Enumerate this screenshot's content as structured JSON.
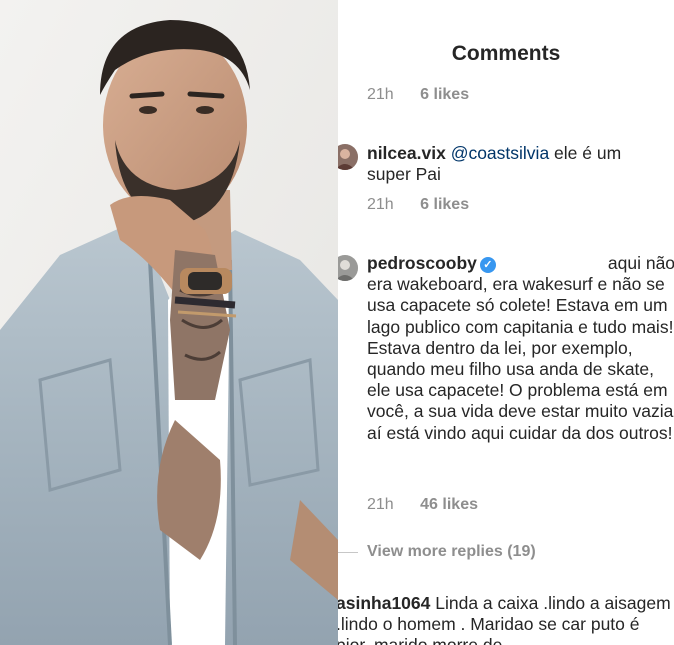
{
  "header": {
    "title": "Comments"
  },
  "comments": [
    {
      "time": "21h",
      "likes": "6 likes"
    },
    {
      "username": "nilcea.vix",
      "mention": "@coastsilvia",
      "text": " ele é um super Pai",
      "time": "21h",
      "likes": "6 likes"
    },
    {
      "username": "pedroscooby",
      "verified": true,
      "text": "aqui não era wakeboard, era wakesurf e não se usa capacete só colete! Estava em um lago publico com capitania e tudo mais! Estava dentro da lei, por exemplo, quando meu filho usa anda de skate, ele usa capacete! O problema está em você, a sua vida deve estar muito vazia, aí está vindo aqui cuidar da dos outros!",
      "time": "21h",
      "likes": "46 likes",
      "view_more": "View more replies (19)"
    },
    {
      "username": "asinha1064",
      "text": " Linda a caixa .lindo a aisagem .lindo o homem . Maridao se car puto é pior. marido morre de"
    }
  ],
  "colors": {
    "text": "#262626",
    "secondary": "#8e8e8e",
    "mention": "#003569",
    "verified": "#3897f0"
  }
}
